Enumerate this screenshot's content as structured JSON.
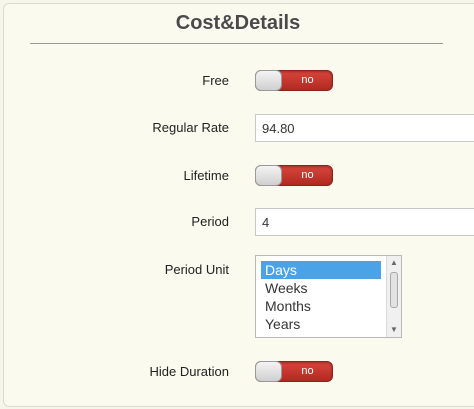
{
  "header": {
    "title": "Cost&Details"
  },
  "fields": {
    "free": {
      "label": "Free",
      "state": "no"
    },
    "regular_rate": {
      "label": "Regular Rate",
      "value": "94.80"
    },
    "lifetime": {
      "label": "Lifetime",
      "state": "no"
    },
    "period": {
      "label": "Period",
      "value": "4"
    },
    "period_unit": {
      "label": "Period Unit",
      "options": [
        "Days",
        "Weeks",
        "Months",
        "Years"
      ],
      "selected": "Days"
    },
    "hide_duration": {
      "label": "Hide Duration",
      "state": "no"
    }
  },
  "colors": {
    "toggle_off": "#c3352c",
    "list_selected": "#4aa3e6",
    "background": "#f6f6ea"
  }
}
